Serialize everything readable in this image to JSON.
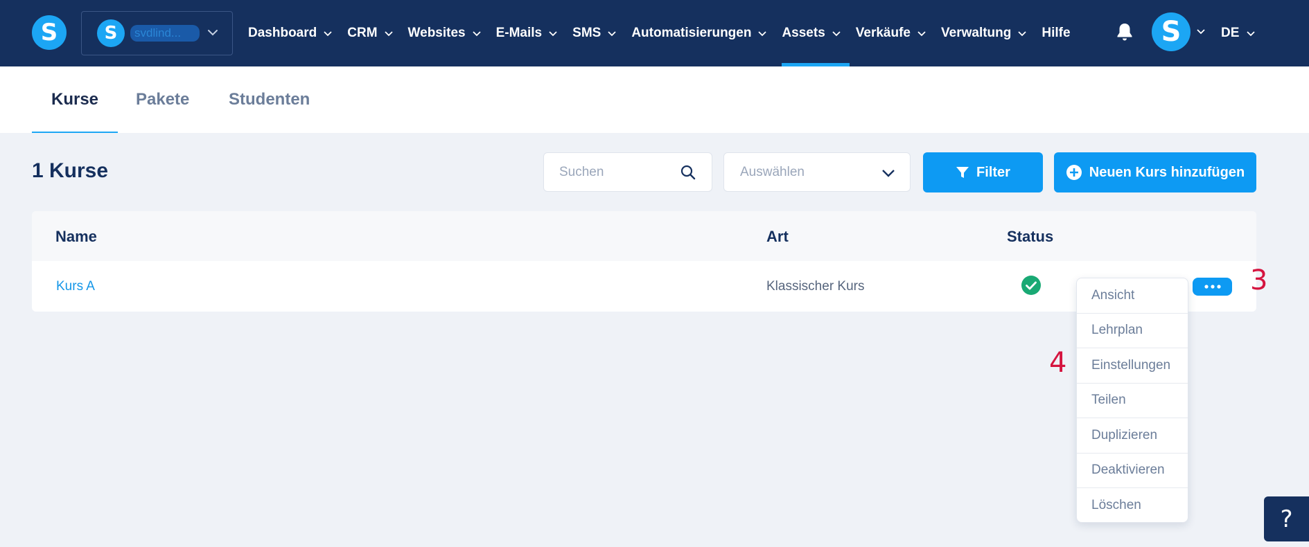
{
  "brand": {
    "logo_letter": "S",
    "accent": "#1ca6f4",
    "navbar_bg": "#15305e"
  },
  "account": {
    "avatar_letter": "S",
    "name": "svdlind..."
  },
  "nav": {
    "items": [
      {
        "label": "Dashboard",
        "active": false
      },
      {
        "label": "CRM",
        "active": false
      },
      {
        "label": "Websites",
        "active": false
      },
      {
        "label": "E-Mails",
        "active": false
      },
      {
        "label": "SMS",
        "active": false
      },
      {
        "label": "Automatisierungen",
        "active": false
      },
      {
        "label": "Assets",
        "active": true
      },
      {
        "label": "Verkäufe",
        "active": false
      },
      {
        "label": "Verwaltung",
        "active": false
      }
    ],
    "help_label": "Hilfe",
    "user_avatar_letter": "S",
    "language": "DE"
  },
  "tabs": [
    {
      "label": "Kurse",
      "active": true
    },
    {
      "label": "Pakete",
      "active": false
    },
    {
      "label": "Studenten",
      "active": false
    }
  ],
  "toolbar": {
    "count_label": "1 Kurse",
    "search_placeholder": "Suchen",
    "select_placeholder": "Auswählen",
    "filter_label": "Filter",
    "add_label": "Neuen Kurs hinzufügen"
  },
  "table": {
    "headers": {
      "name": "Name",
      "type": "Art",
      "status": "Status"
    },
    "rows": [
      {
        "name": "Kurs A",
        "type": "Klassischer Kurs",
        "status": "active",
        "status_color": "#19a974"
      }
    ]
  },
  "row_menu": {
    "items": [
      "Ansicht",
      "Lehrplan",
      "Einstellungen",
      "Teilen",
      "Duplizieren",
      "Deaktivieren",
      "Löschen"
    ]
  },
  "annotations": {
    "a3": "3",
    "a4": "4"
  },
  "help_button": "?"
}
